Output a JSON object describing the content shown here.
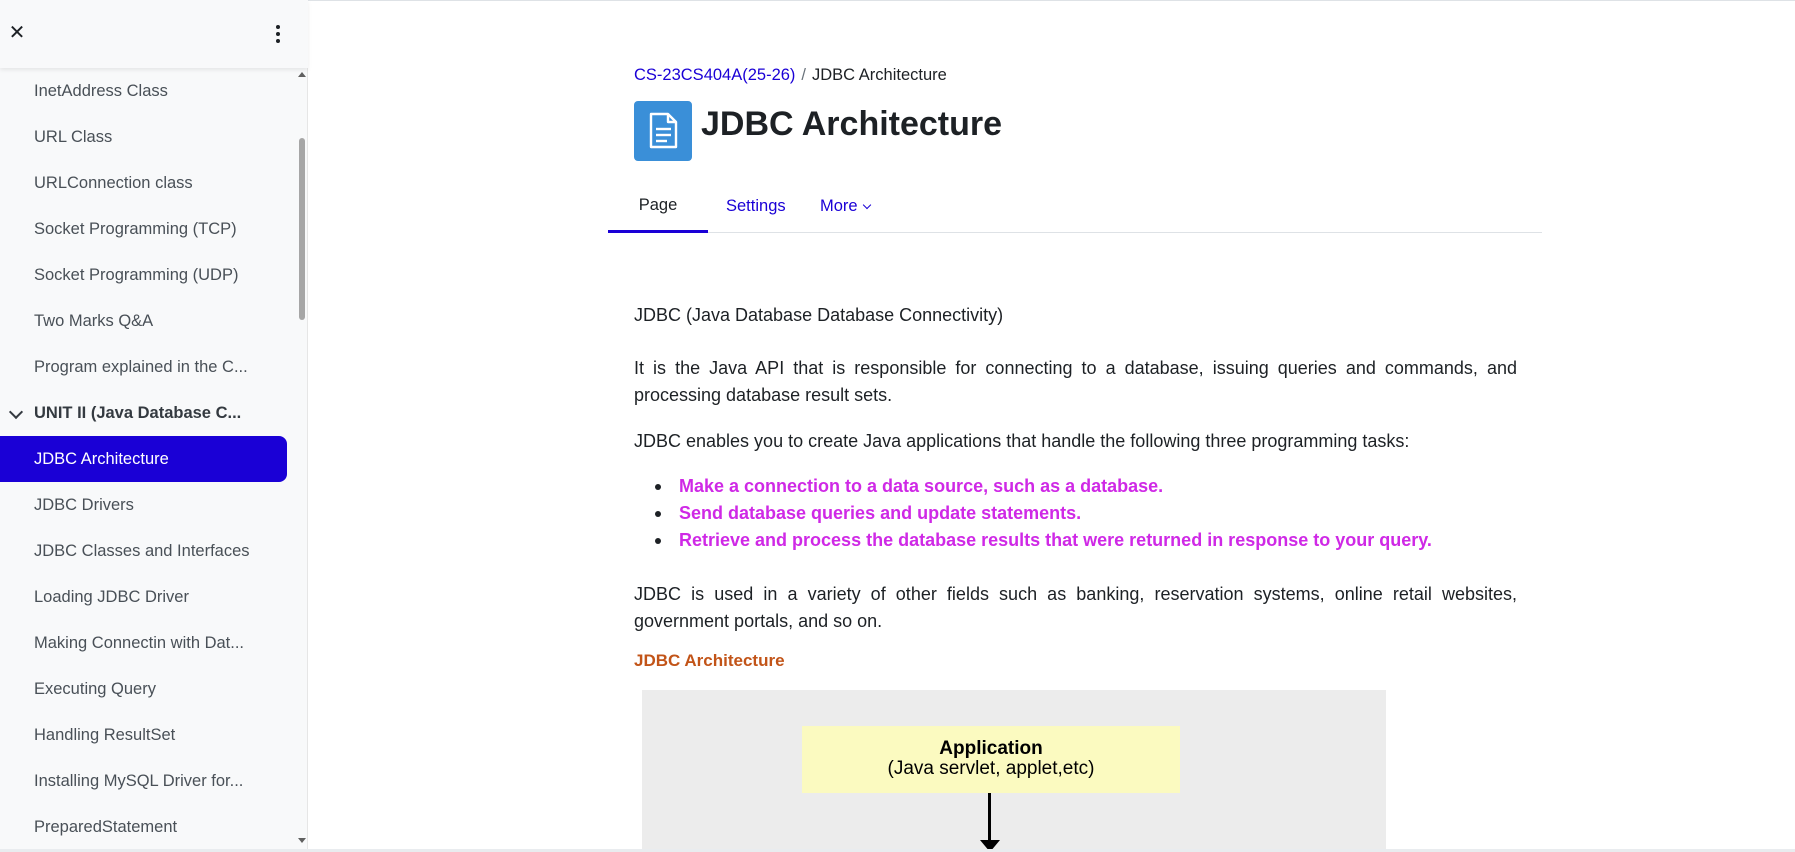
{
  "sidebar": {
    "items": [
      {
        "label": "InetAddress Class",
        "type": "item"
      },
      {
        "label": "URL Class",
        "type": "item"
      },
      {
        "label": "URLConnection class",
        "type": "item"
      },
      {
        "label": "Socket Programming (TCP)",
        "type": "item"
      },
      {
        "label": "Socket Programming (UDP)",
        "type": "item"
      },
      {
        "label": "Two Marks Q&A",
        "type": "item"
      },
      {
        "label": "Program explained in the C...",
        "type": "item"
      },
      {
        "label": "UNIT II (Java Database C...",
        "type": "section"
      },
      {
        "label": "JDBC Architecture",
        "type": "active"
      },
      {
        "label": "JDBC Drivers",
        "type": "item"
      },
      {
        "label": "JDBC Classes and Interfaces",
        "type": "item"
      },
      {
        "label": "Loading JDBC Driver",
        "type": "item"
      },
      {
        "label": "Making Connectin with Dat...",
        "type": "item"
      },
      {
        "label": "Executing Query",
        "type": "item"
      },
      {
        "label": "Handling ResultSet",
        "type": "item"
      },
      {
        "label": "Installing MySQL Driver for...",
        "type": "item"
      },
      {
        "label": "PreparedStatement",
        "type": "item"
      }
    ]
  },
  "breadcrumb": {
    "course": "CS-23CS404A(25-26)",
    "separator": "/",
    "current": "JDBC Architecture"
  },
  "header": {
    "title": "JDBC Architecture"
  },
  "tabs": {
    "page": "Page",
    "settings": "Settings",
    "more": "More"
  },
  "content": {
    "p1": "JDBC (Java Database Database Connectivity)",
    "p2": "It is the Java API that is responsible for connecting to a database, issuing queries and commands, and processing database result sets.",
    "p3": "JDBC enables you to create Java applications that handle the following three programming tasks:",
    "bullets": [
      "Make a connection to a data source, such as a database.",
      "Send database queries and update statements.",
      "Retrieve and process the database results that were returned in response to your query."
    ],
    "p4": "JDBC is used in a variety of other fields such as banking, reservation systems, online retail websites, government portals, and so on.",
    "heading": "JDBC Architecture"
  },
  "diagram": {
    "app_title": "Application",
    "app_subtitle": "(Java servlet, applet,etc)"
  },
  "colors": {
    "accent": "#1a00d6",
    "bullet_text": "#cf29e6",
    "heading_orange": "#c25418",
    "page_icon": "#3a8fd8",
    "app_box": "#fbfac0"
  },
  "icons": {
    "close": "close-icon",
    "kebab": "kebab-menu-icon",
    "page": "page-icon",
    "chevron": "chevron-down-icon"
  }
}
